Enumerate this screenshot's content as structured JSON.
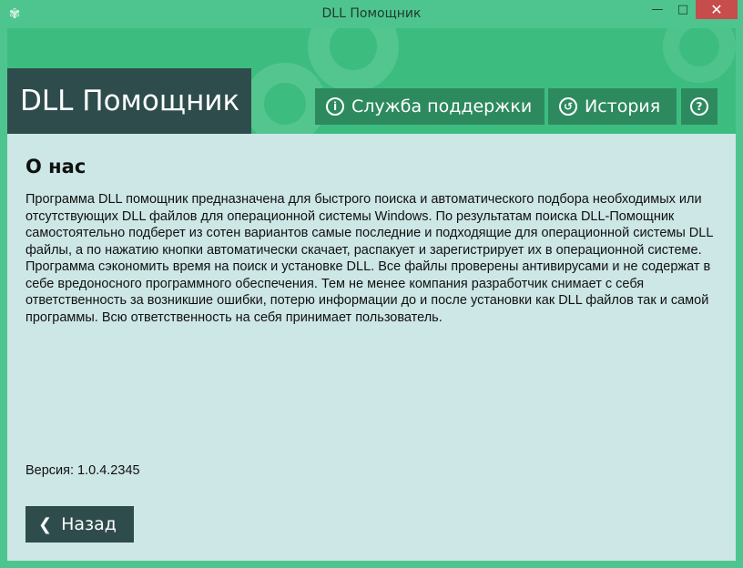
{
  "window": {
    "title": "DLL Помощник",
    "minimize": "—",
    "maximize": "□",
    "close": "✕",
    "app_icon": "✾"
  },
  "header": {
    "brand": "DLL Помощник",
    "support_label": "Служба поддержки",
    "history_label": "История",
    "icons": {
      "support": "info-circle-icon",
      "history": "history-icon",
      "help": "question-circle-icon"
    }
  },
  "content": {
    "title": "О нас",
    "text": "Программа DLL помощник предназначена для быстрого поиска и автоматического подбора необходимых или отсутствующих DLL файлов для операционной системы Windows. По результатам поиска DLL-Помощник самостоятельно подберет из сотен вариантов самые последние и подходящие для операционной системы DLL файлы, а по нажатию кнопки автоматически скачает, распакует и зарегистрирует их в операционной системе. Программа сэкономить время на поиск и установке DLL. Все файлы проверены антивирусами и не содержат в себе вредоносного программного обеспечения. Тем не менее компания разработчик снимает с себя ответственность за возникшие ошибки, потерю информации до и после установки как DLL файлов так и самой программы. Всю ответственность на себя принимает пользователь.",
    "version_label": "Версия:",
    "version_value": "1.0.4.2345",
    "back_label": "Назад"
  },
  "colors": {
    "accent": "#4ec58e",
    "header": "#3cbd7f",
    "button": "#2d8a5f",
    "dark": "#2f4c4d",
    "content_bg": "#cde6e6",
    "close": "#c74c4c"
  }
}
